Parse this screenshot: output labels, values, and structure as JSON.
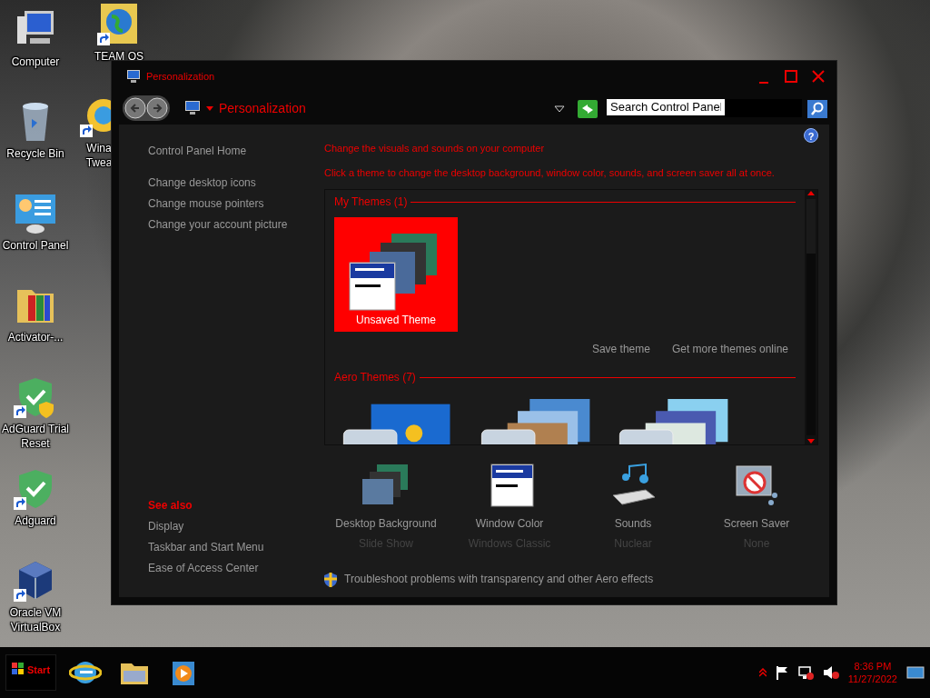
{
  "desktop_icons": [
    {
      "kind": "computer",
      "label": "Computer",
      "shortcut": false
    },
    {
      "kind": "recycle",
      "label": "Recycle Bin",
      "shortcut": false
    },
    {
      "kind": "control",
      "label": "Control Panel",
      "shortcut": false
    },
    {
      "kind": "folder",
      "label": "Activator-...",
      "shortcut": false
    },
    {
      "kind": "shield-uac",
      "label": "AdGuard Trial Reset",
      "shortcut": true
    },
    {
      "kind": "shield",
      "label": "Adguard",
      "shortcut": true
    },
    {
      "kind": "box",
      "label": "Oracle VM VirtualBox",
      "shortcut": true
    }
  ],
  "desktop_icons_2": [
    {
      "kind": "globe",
      "label": "TEAM OS",
      "shortcut": true
    },
    {
      "kind": "tweaker",
      "label": "Wina Twea",
      "shortcut": true
    }
  ],
  "window": {
    "title": "Personalization",
    "address": {
      "breadcrumb": "Personalization",
      "search_placeholder": "Search Control Panel"
    },
    "sidebar": {
      "home": "Control Panel Home",
      "links": [
        "Change desktop icons",
        "Change mouse pointers",
        "Change your account picture"
      ],
      "see_also_heading": "See also",
      "see_also": [
        "Display",
        "Taskbar and Start Menu",
        "Ease of Access Center"
      ]
    },
    "help": "?",
    "heading": "Change the visuals and sounds on your computer",
    "subheading": "Click a theme to change the desktop background, window color, sounds, and screen saver all at once.",
    "my_themes": {
      "heading": "My Themes (1)",
      "items": [
        {
          "name": "Unsaved Theme",
          "selected": true
        }
      ]
    },
    "theme_links": [
      "Save theme",
      "Get more themes online"
    ],
    "aero_themes": {
      "heading": "Aero Themes (7)",
      "items": [
        {
          "kind": "windows",
          "selected": false
        },
        {
          "kind": "architecture",
          "selected": false
        },
        {
          "kind": "characters",
          "selected": false
        }
      ]
    },
    "settings": [
      {
        "kind": "background",
        "label": "Desktop Background",
        "value": "Slide Show"
      },
      {
        "kind": "color",
        "label": "Window Color",
        "value": "Windows Classic"
      },
      {
        "kind": "sounds",
        "label": "Sounds",
        "value": "Nuclear"
      },
      {
        "kind": "saver",
        "label": "Screen Saver",
        "value": "None"
      }
    ],
    "troubleshoot": "Troubleshoot problems with transparency and other Aero effects"
  },
  "taskbar": {
    "start": "Start",
    "pinned": [
      {
        "kind": "browser"
      },
      {
        "kind": "folder"
      },
      {
        "kind": "player"
      }
    ],
    "clock_time": "8:36 PM",
    "clock_date": "11/27/2022"
  }
}
